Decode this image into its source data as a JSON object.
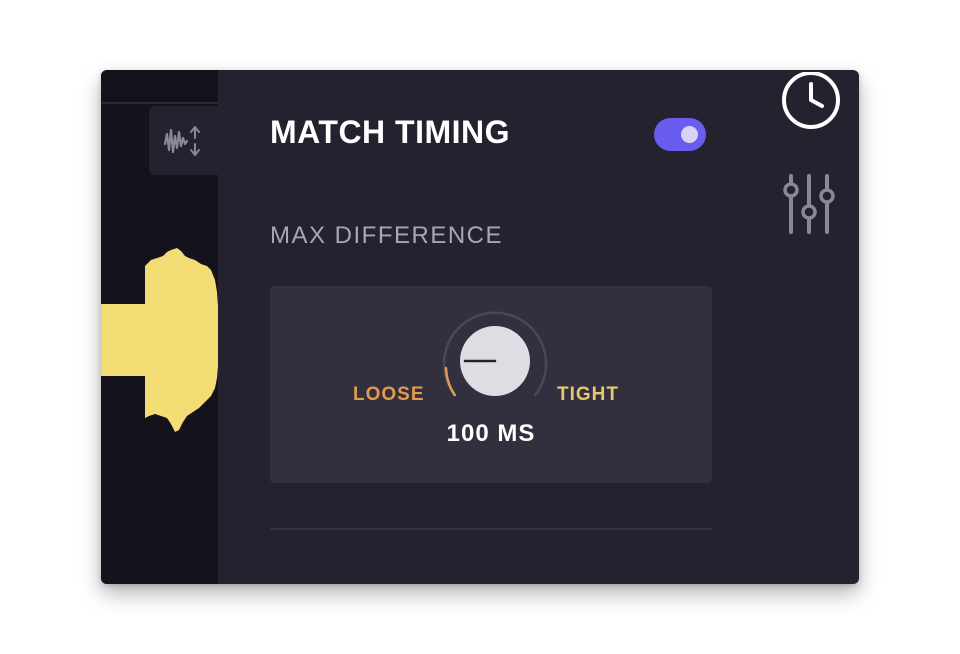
{
  "panel": {
    "title": "MATCH TIMING",
    "toggle_on": true,
    "section_label": "MAX DIFFERENCE"
  },
  "knob": {
    "label_left": "LOOSE",
    "label_right": "TIGHT",
    "value_text": "100 MS",
    "value_fraction": 0.1
  },
  "icons": {
    "waveform_tab": "waveform-arrows-icon",
    "history": "clock-icon",
    "mixer": "sliders-icon"
  },
  "colors": {
    "accent": "#6b5cf0",
    "loose": "#e39a4d",
    "tight": "#e9c76c",
    "waveform": "#f4dc75",
    "panel_bg": "#23222e",
    "card_bg": "#32303f"
  }
}
